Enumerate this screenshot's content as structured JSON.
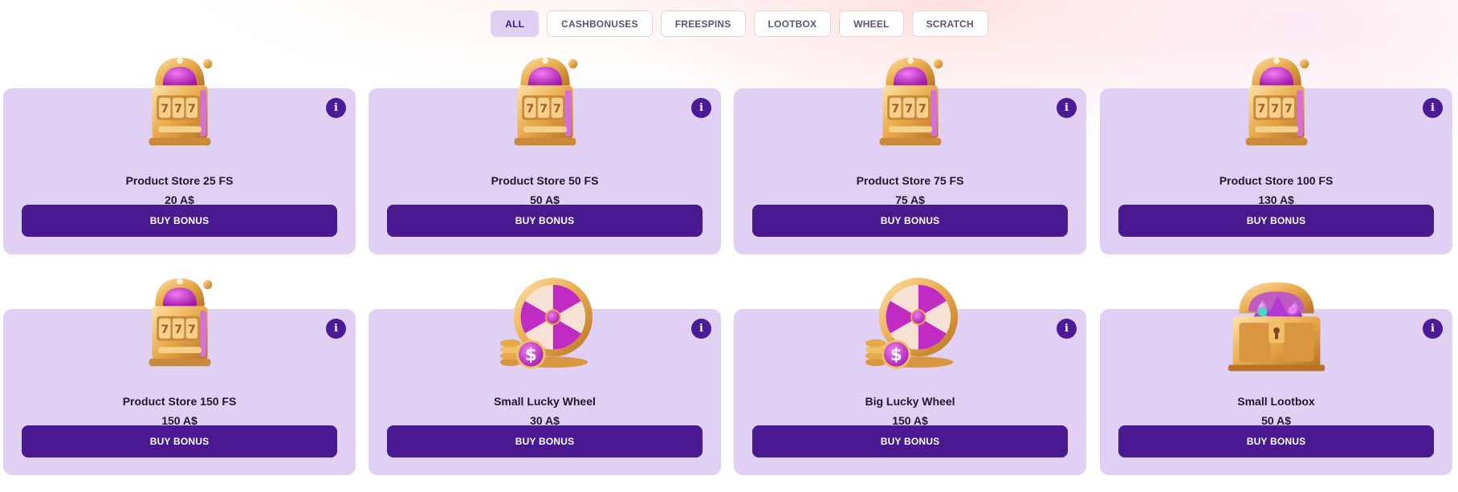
{
  "filters": [
    {
      "label": "ALL",
      "active": true
    },
    {
      "label": "CASHBONUSES",
      "active": false
    },
    {
      "label": "FREESPINS",
      "active": false
    },
    {
      "label": "LOOTBOX",
      "active": false
    },
    {
      "label": "WHEEL",
      "active": false
    },
    {
      "label": "SCRATCH",
      "active": false
    }
  ],
  "products": [
    {
      "title": "Product Store 25 FS",
      "price": "20 A$",
      "button": "BUY BONUS",
      "icon": "slot-machine-icon"
    },
    {
      "title": "Product Store 50 FS",
      "price": "50 A$",
      "button": "BUY BONUS",
      "icon": "slot-machine-icon"
    },
    {
      "title": "Product Store 75 FS",
      "price": "75 A$",
      "button": "BUY BONUS",
      "icon": "slot-machine-icon"
    },
    {
      "title": "Product Store 100 FS",
      "price": "130 A$",
      "button": "BUY BONUS",
      "icon": "slot-machine-icon"
    },
    {
      "title": "Product Store 150 FS",
      "price": "150 A$",
      "button": "BUY BONUS",
      "icon": "slot-machine-icon"
    },
    {
      "title": "Small Lucky Wheel",
      "price": "30 A$",
      "button": "BUY BONUS",
      "icon": "lucky-wheel-icon"
    },
    {
      "title": "Big Lucky Wheel",
      "price": "150 A$",
      "button": "BUY BONUS",
      "icon": "lucky-wheel-icon"
    },
    {
      "title": "Small Lootbox",
      "price": "50 A$",
      "button": "BUY BONUS",
      "icon": "treasure-chest-icon"
    }
  ],
  "info_glyph": "i",
  "colors": {
    "card_bg": "#e0d0f3",
    "button_bg": "#48198f",
    "info_bg": "#4a1a97",
    "filter_active_bg": "#ded0f2",
    "gold": "#e8a94a",
    "magenta": "#c02bc4"
  }
}
